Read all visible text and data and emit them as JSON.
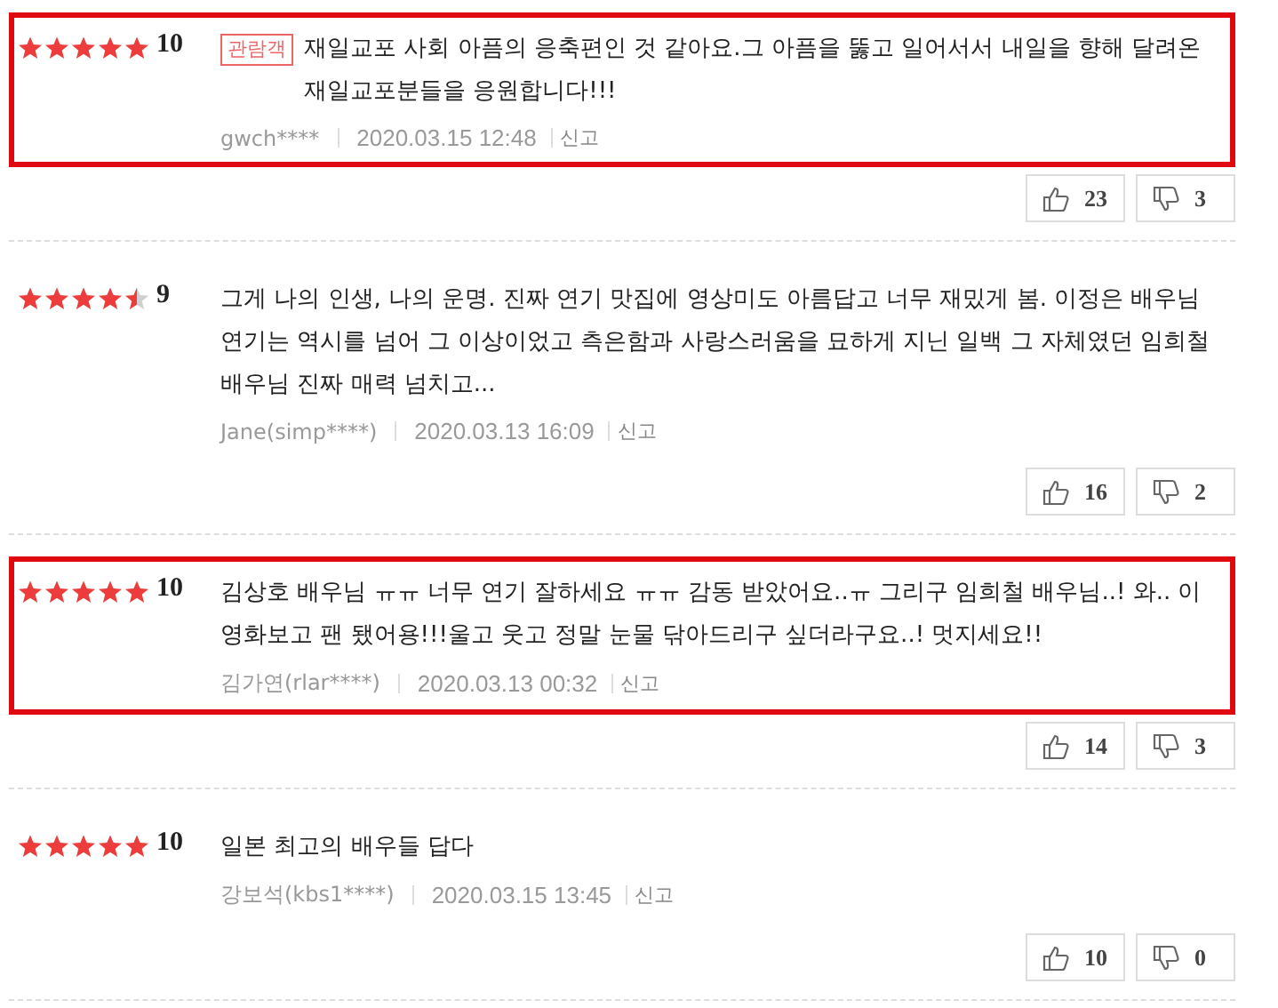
{
  "reviews": [
    {
      "stars": 5,
      "score": "10",
      "highlighted": true,
      "badge": "관람객",
      "text": "재일교포 사회 아픔의 응축편인 것 같아요.그 아픔을 뚫고 일어서서 내일을 향해 달려온 재일교포분들을 응원합니다!!!",
      "author": "gwch****",
      "date": "2020.03.15 12:48",
      "report": "신고",
      "likes": "23",
      "dislikes": "3"
    },
    {
      "stars": 4.5,
      "score": "9",
      "highlighted": false,
      "text": "그게 나의 인생, 나의 운명. 진짜 연기 맛집에 영상미도 아름답고 너무 재밌게 봄. 이정은 배우님 연기는 역시를 넘어 그 이상이었고 측은함과 사랑스러움을 묘하게 지닌 일백 그 자체였던 임희철 배우님 진짜 매력 넘치고...",
      "author": "Jane(simp****)",
      "date": "2020.03.13 16:09",
      "report": "신고",
      "likes": "16",
      "dislikes": "2"
    },
    {
      "stars": 5,
      "score": "10",
      "highlighted": true,
      "text": "김상호 배우님 ㅠㅠ 너무 연기 잘하세요 ㅠㅠ 감동 받았어요..ㅠ 그리구 임희철 배우님..! 와.. 이 영화보고 팬 됐어용!!!울고 웃고 정말 눈물 닦아드리구 싶더라구요..! 멋지세요!!",
      "author": "김가연(rlar****)",
      "date": "2020.03.13 00:32",
      "report": "신고",
      "likes": "14",
      "dislikes": "3"
    },
    {
      "stars": 5,
      "score": "10",
      "highlighted": false,
      "text": "일본 최고의 배우들 답다",
      "author": "강보석(kbs1****)",
      "date": "2020.03.15 13:45",
      "report": "신고",
      "likes": "10",
      "dislikes": "0"
    }
  ]
}
